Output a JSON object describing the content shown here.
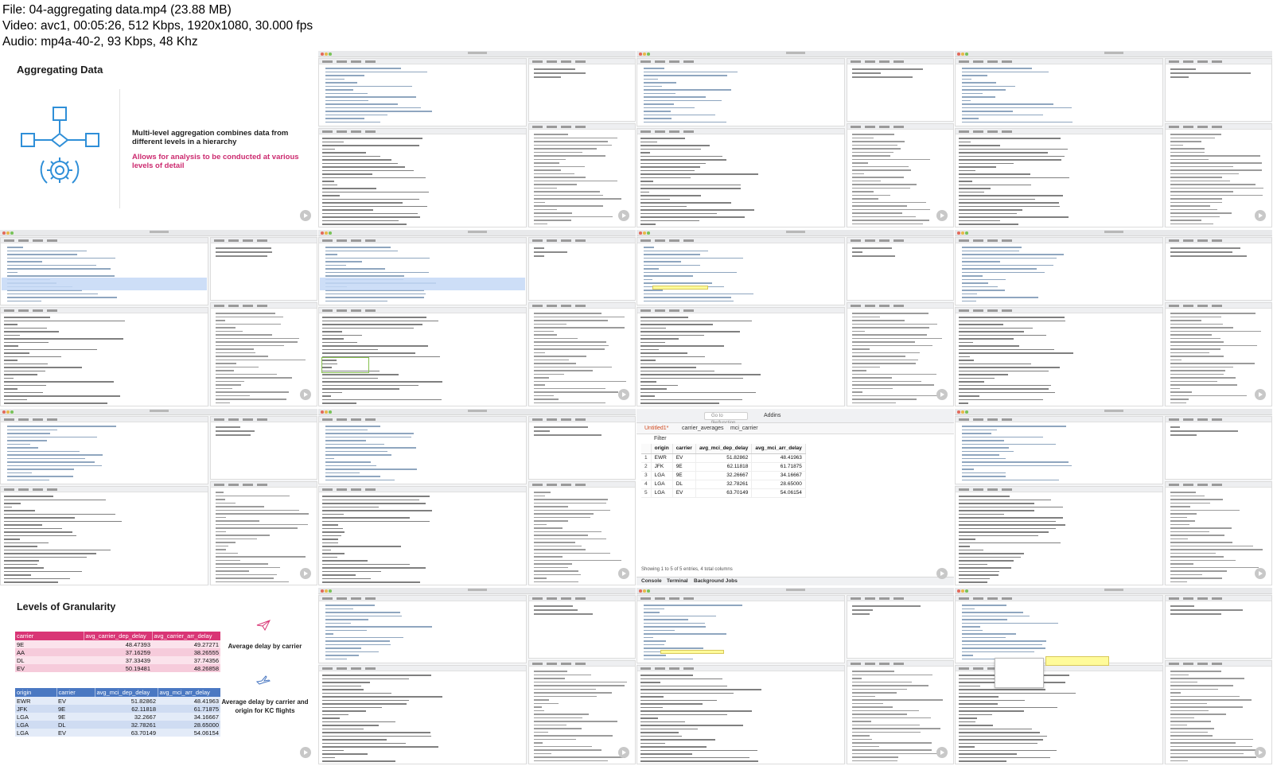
{
  "header": {
    "file_line": "File: 04-aggregating data.mp4 (23.88 MB)",
    "video_line": "Video: avc1, 00:05:26, 512 Kbps, 1920x1080, 30.000 fps",
    "audio_line": "Audio: mp4a-40-2, 93 Kbps, 48 Khz"
  },
  "slide1": {
    "title": "Aggregating Data",
    "point1": "Multi-level aggregation combines data from different levels in a hierarchy",
    "point2": "Allows for analysis to be conducted at various levels of detail",
    "accent_color": "#cc2a6f",
    "icon_color": "#2f8fd8"
  },
  "viewer": {
    "goto_placeholder": "Go to file/function",
    "addins_label": "Addins",
    "tabs": [
      "Untitled1*",
      "carrier_averages",
      "mci_carrier"
    ],
    "filter_label": "Filter",
    "columns": [
      "origin",
      "carrier",
      "avg_mci_dep_delay",
      "avg_mci_arr_delay"
    ],
    "rows": [
      {
        "idx": "1",
        "origin": "EWR",
        "carrier": "EV",
        "dep": "51.82862",
        "arr": "48.41963"
      },
      {
        "idx": "2",
        "origin": "JFK",
        "carrier": "9E",
        "dep": "62.11818",
        "arr": "61.71875"
      },
      {
        "idx": "3",
        "origin": "LGA",
        "carrier": "9E",
        "dep": "32.26667",
        "arr": "34.16667"
      },
      {
        "idx": "4",
        "origin": "LGA",
        "carrier": "DL",
        "dep": "32.78261",
        "arr": "28.65000"
      },
      {
        "idx": "5",
        "origin": "LGA",
        "carrier": "EV",
        "dep": "63.70149",
        "arr": "54.06154"
      }
    ],
    "footer": "Showing 1 to 5 of 5 entries, 4 total columns",
    "console_tabs": [
      "Console",
      "Terminal",
      "Background Jobs"
    ]
  },
  "slide2": {
    "title": "Levels of Granularity",
    "table1": {
      "columns": [
        "carrier",
        "avg_carrier_dep_delay",
        "avg_carrier_arr_delay"
      ],
      "rows": [
        [
          "9E",
          "48.47393",
          "49.27271"
        ],
        [
          "AA",
          "37.16259",
          "38.26555"
        ],
        [
          "DL",
          "37.33439",
          "37.74356"
        ],
        [
          "EV",
          "50.19481",
          "48.26858"
        ]
      ]
    },
    "table2": {
      "columns": [
        "origin",
        "carrier",
        "avg_mci_dep_delay",
        "avg_mci_arr_delay"
      ],
      "rows": [
        [
          "EWR",
          "EV",
          "51.82862",
          "48.41963"
        ],
        [
          "JFK",
          "9E",
          "62.11818",
          "61.71875"
        ],
        [
          "LGA",
          "9E",
          "32.2667",
          "34.16667"
        ],
        [
          "LGA",
          "DL",
          "32.78261",
          "28.65000"
        ],
        [
          "LGA",
          "EV",
          "63.70149",
          "54.06154"
        ]
      ]
    },
    "caption1": "Average delay by carrier",
    "caption2": "Average delay by carrier and origin for KC flights",
    "color_pink": "#d93575",
    "color_blue": "#4a78c2"
  }
}
